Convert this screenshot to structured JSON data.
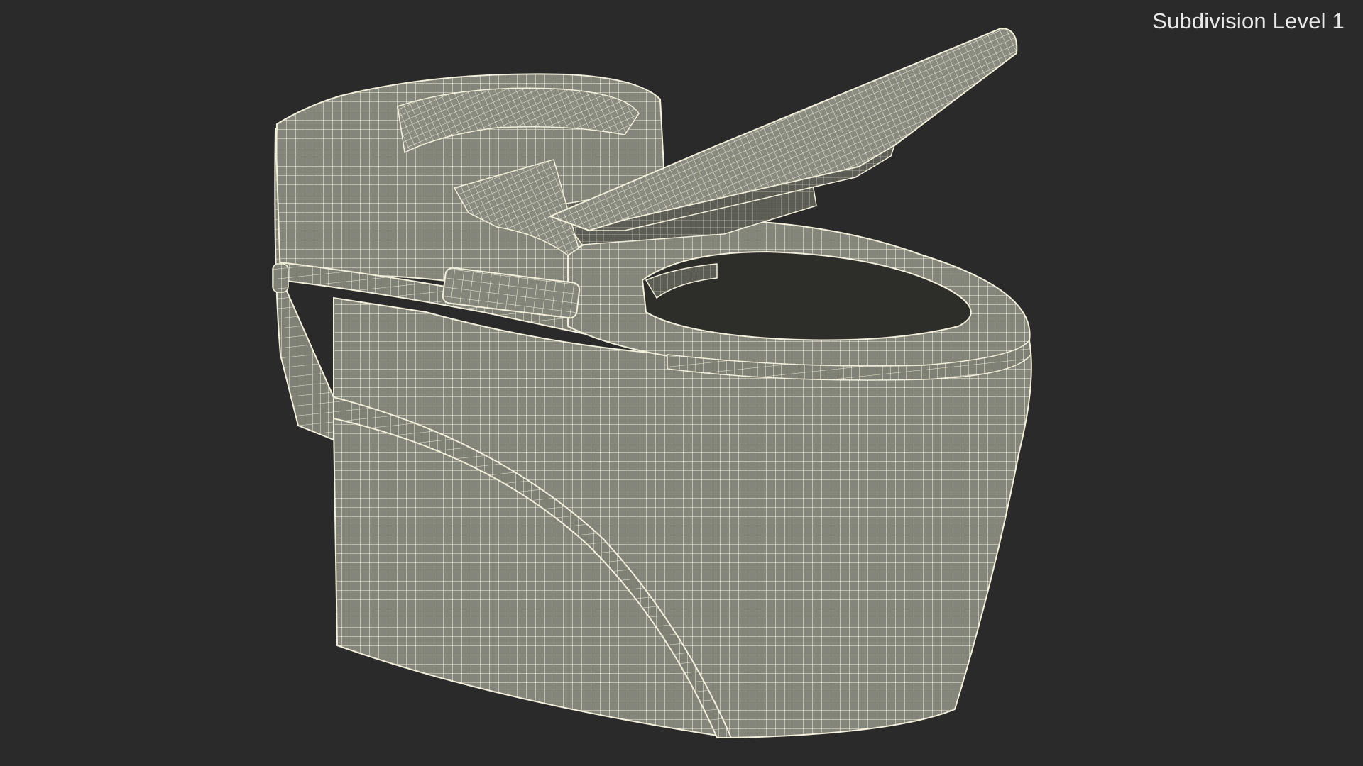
{
  "viewport": {
    "label": "Subdivision Level 1",
    "background": "#2a2a2a",
    "mesh_fill": "#85867b",
    "mesh_wire": "#f2f0dc",
    "shadow_fill": "#4d4e47"
  }
}
